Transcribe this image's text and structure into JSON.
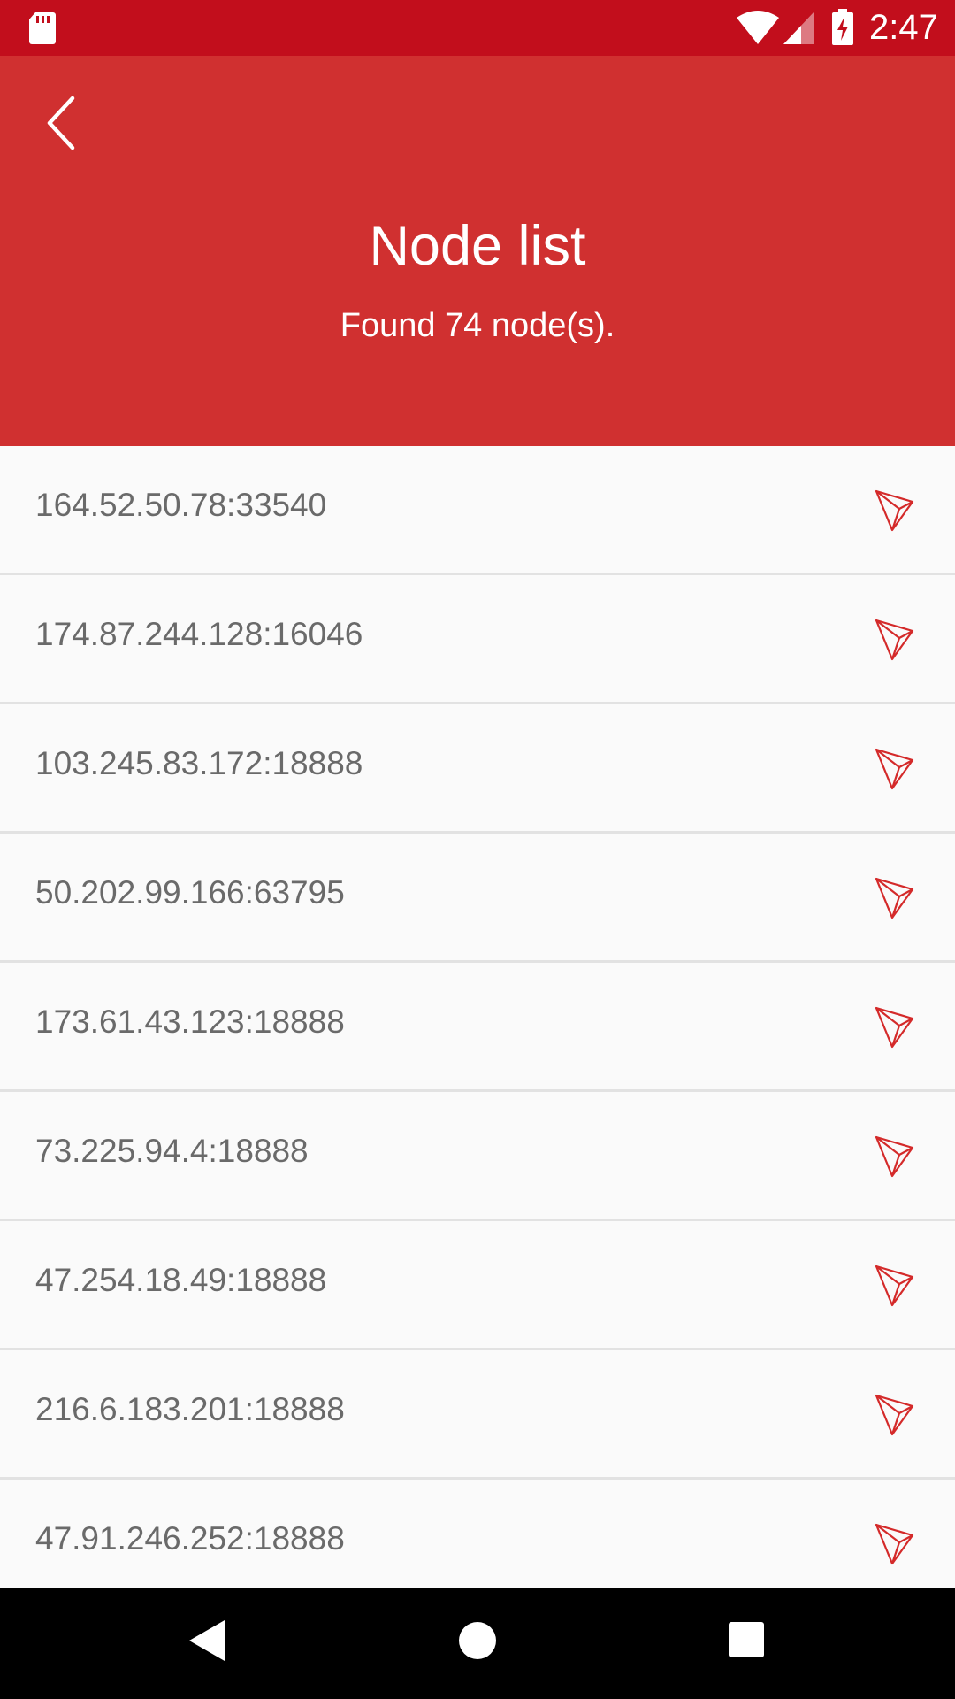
{
  "status_bar": {
    "time": "2:47",
    "icons": [
      "sd-card-icon",
      "wifi-icon",
      "cell-signal-icon",
      "battery-charging-icon"
    ],
    "background_color": "#c20e1c"
  },
  "header": {
    "back_icon": "chevron-left-icon",
    "title": "Node list",
    "subtitle": "Found 74 node(s).",
    "background_color": "#d03030"
  },
  "nodes": [
    {
      "address": "164.52.50.78:33540",
      "icon": "tron-logo-icon"
    },
    {
      "address": "174.87.244.128:16046",
      "icon": "tron-logo-icon"
    },
    {
      "address": "103.245.83.172:18888",
      "icon": "tron-logo-icon"
    },
    {
      "address": "50.202.99.166:63795",
      "icon": "tron-logo-icon"
    },
    {
      "address": "173.61.43.123:18888",
      "icon": "tron-logo-icon"
    },
    {
      "address": "73.225.94.4:18888",
      "icon": "tron-logo-icon"
    },
    {
      "address": "47.254.18.49:18888",
      "icon": "tron-logo-icon"
    },
    {
      "address": "216.6.183.201:18888",
      "icon": "tron-logo-icon"
    },
    {
      "address": "47.91.246.252:18888",
      "icon": "tron-logo-icon"
    }
  ],
  "nav_bar": {
    "icons": [
      "nav-back-icon",
      "nav-home-icon",
      "nav-recents-icon"
    ]
  },
  "colors": {
    "accent": "#d03030",
    "icon_red": "#d42a2a",
    "text_gray": "#6a6a6a"
  }
}
